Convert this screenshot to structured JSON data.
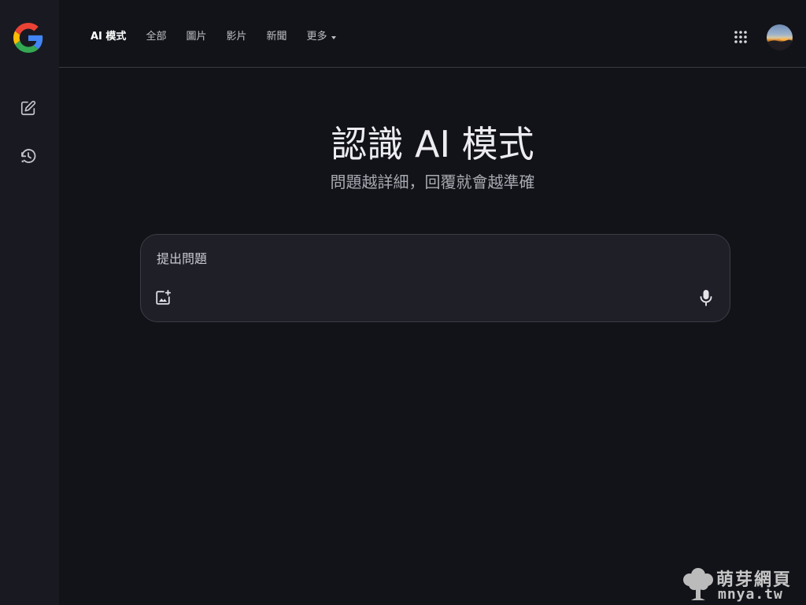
{
  "sidebar": {
    "logo_icon": "google-g-logo",
    "new_chat_icon": "edit-square-icon",
    "history_icon": "history-icon"
  },
  "header": {
    "tabs": [
      {
        "label": "AI 模式",
        "active": true
      },
      {
        "label": "全部",
        "active": false
      },
      {
        "label": "圖片",
        "active": false
      },
      {
        "label": "影片",
        "active": false
      },
      {
        "label": "新聞",
        "active": false
      },
      {
        "label": "更多",
        "active": false,
        "dropdown": true
      }
    ],
    "apps_icon": "apps-grid-icon",
    "avatar_icon": "profile-avatar"
  },
  "main": {
    "title": "認識 AI 模式",
    "subtitle": "問題越詳細，回覆就會越準確"
  },
  "askbox": {
    "placeholder": "提出問題",
    "value": "",
    "image_icon": "add-image-icon",
    "mic_icon": "microphone-icon"
  },
  "watermark": {
    "title": "萌芽網頁",
    "domain": "mnya.tw"
  },
  "colors": {
    "background": "#121318",
    "sidebar": "#191a21",
    "askbox": "#1e1f27",
    "google_blue": "#4285F4",
    "google_red": "#EA4335",
    "google_yellow": "#FBBC05",
    "google_green": "#34A853"
  }
}
